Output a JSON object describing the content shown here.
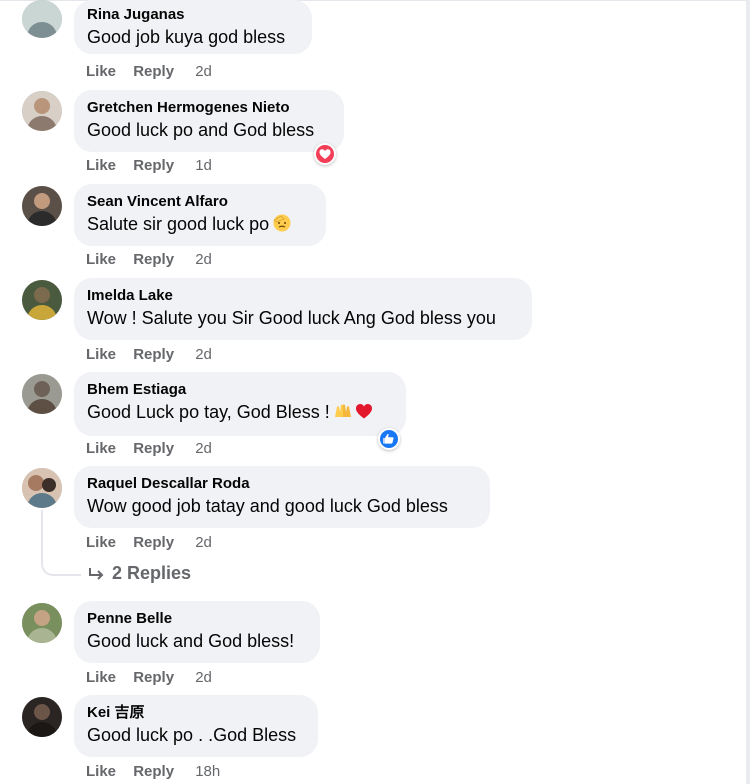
{
  "comments": [
    {
      "name": "Rina Juganas",
      "text": "Good job kuya god bless",
      "like": "Like",
      "reply": "Reply",
      "time": "2d"
    },
    {
      "name": "Gretchen Hermogenes Nieto",
      "text": "Good luck po and God bless",
      "like": "Like",
      "reply": "Reply",
      "time": "1d",
      "reaction": "love"
    },
    {
      "name": "Sean Vincent Alfaro",
      "text": "Salute sir good luck po",
      "emoji": "saluting-face",
      "like": "Like",
      "reply": "Reply",
      "time": "2d"
    },
    {
      "name": "Imelda Lake",
      "text": "Wow ! Salute you Sir Good luck Ang God bless you",
      "like": "Like",
      "reply": "Reply",
      "time": "2d"
    },
    {
      "name": "Bhem Estiaga",
      "text": "Good Luck po tay, God Bless !",
      "emoji": "raised-hands and red-heart",
      "like": "Like",
      "reply": "Reply",
      "time": "2d",
      "reaction": "like"
    },
    {
      "name": "Raquel Descallar Roda",
      "text": "Wow good job tatay and good luck God bless",
      "like": "Like",
      "reply": "Reply",
      "time": "2d"
    },
    {
      "name": "Penne Belle",
      "text": "Good luck and God bless!",
      "like": "Like",
      "reply": "Reply",
      "time": "2d"
    },
    {
      "name": "Kei 吉原",
      "text": "Good luck po . .God Bless",
      "like": "Like",
      "reply": "Reply",
      "time": "18h"
    }
  ],
  "replies_link": "2 Replies",
  "colors": {
    "bubble": "#f0f2f5",
    "meta": "#65676b",
    "love": "#f33e58",
    "like": "#1877f2"
  }
}
